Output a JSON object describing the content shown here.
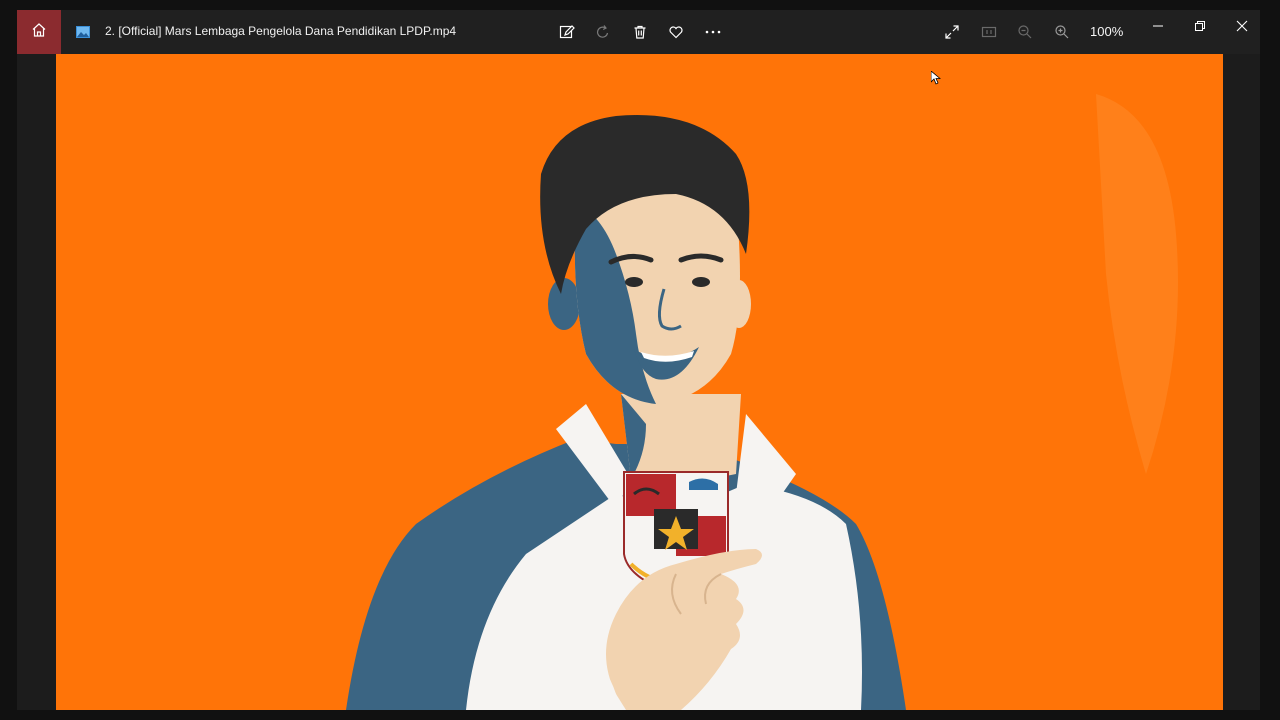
{
  "titlebar": {
    "title": "2. [Official] Mars Lembaga Pengelola Dana Pendidikan LPDP.mp4",
    "zoom": "100%"
  },
  "icons": {
    "home": "home-icon",
    "file": "image-file-icon",
    "edit": "edit-image-icon",
    "rotate": "rotate-icon",
    "delete": "trash-icon",
    "favorite": "heart-icon",
    "more": "more-options-icon",
    "fullscreen": "expand-icon",
    "actual_size": "actual-size-icon",
    "zoom_out": "zoom-out-icon",
    "zoom_in": "zoom-in-icon",
    "minimize": "minimize-icon",
    "restore": "restore-icon",
    "close": "close-icon"
  },
  "colors": {
    "accent_home": "#8b2b2f",
    "titlebar": "#202020",
    "background": "#ff7408"
  }
}
